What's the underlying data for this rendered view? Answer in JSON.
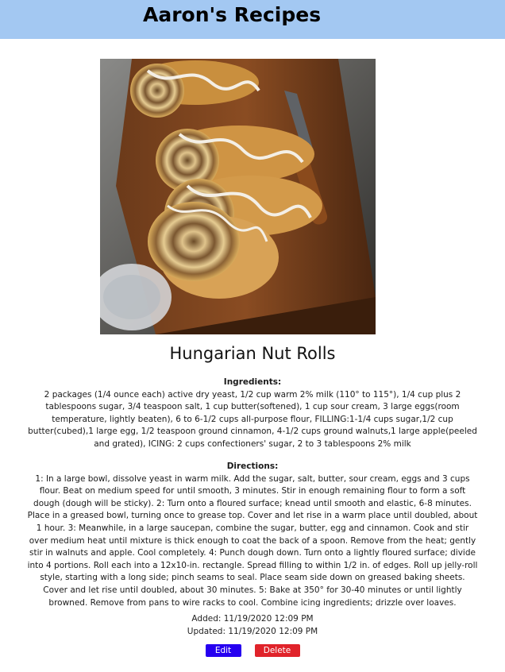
{
  "header": {
    "site_title": "Aaron's Recipes"
  },
  "recipe": {
    "image_alt": "Sliced Hungarian nut rolls drizzled with icing on a wooden board",
    "title": "Hungarian Nut Rolls",
    "ingredients_heading": "Ingredients:",
    "ingredients_text": "2 packages (1/4 ounce each) active dry yeast, 1/2 cup warm 2% milk (110° to 115°), 1/4 cup plus 2 tablespoons sugar, 3/4 teaspoon salt, 1 cup butter(softened), 1 cup sour cream, 3 large eggs(room temperature, lightly beaten), 6 to 6-1/2 cups all-purpose flour, FILLING:1-1/4 cups sugar,1/2 cup butter(cubed),1 large egg, 1/2 teaspoon ground cinnamon, 4-1/2 cups ground walnuts,1 large apple(peeled and grated), ICING: 2 cups confectioners' sugar, 2 to 3 tablespoons 2% milk",
    "directions_heading": "Directions:",
    "directions_text": "1: In a large bowl, dissolve yeast in warm milk. Add the sugar, salt, butter, sour cream, eggs and 3 cups flour. Beat on medium speed for until smooth, 3 minutes. Stir in enough remaining flour to form a soft dough (dough will be sticky). 2: Turn onto a floured surface; knead until smooth and elastic, 6-8 minutes. Place in a greased bowl, turning once to grease top. Cover and let rise in a warm place until doubled, about 1 hour. 3: Meanwhile, in a large saucepan, combine the sugar, butter, egg and cinnamon. Cook and stir over medium heat until mixture is thick enough to coat the back of a spoon. Remove from the heat; gently stir in walnuts and apple. Cool completely. 4: Punch dough down. Turn onto a lightly floured surface; divide into 4 portions. Roll each into a 12x10-in. rectangle. Spread filling to within 1/2 in. of edges. Roll up jelly-roll style, starting with a long side; pinch seams to seal. Place seam side down on greased baking sheets. Cover and let rise until doubled, about 30 minutes. 5: Bake at 350° for 30-40 minutes or until lightly browned. Remove from pans to wire racks to cool. Combine icing ingredients; drizzle over loaves.",
    "added": "Added: 11/19/2020 12:09 PM",
    "updated": "Updated: 11/19/2020 12:09 PM"
  },
  "actions": {
    "edit_label": "Edit",
    "delete_label": "Delete"
  },
  "colors": {
    "header_bg": "#a3c8f2",
    "edit_bg": "#2600f0",
    "delete_bg": "#e0232a"
  }
}
